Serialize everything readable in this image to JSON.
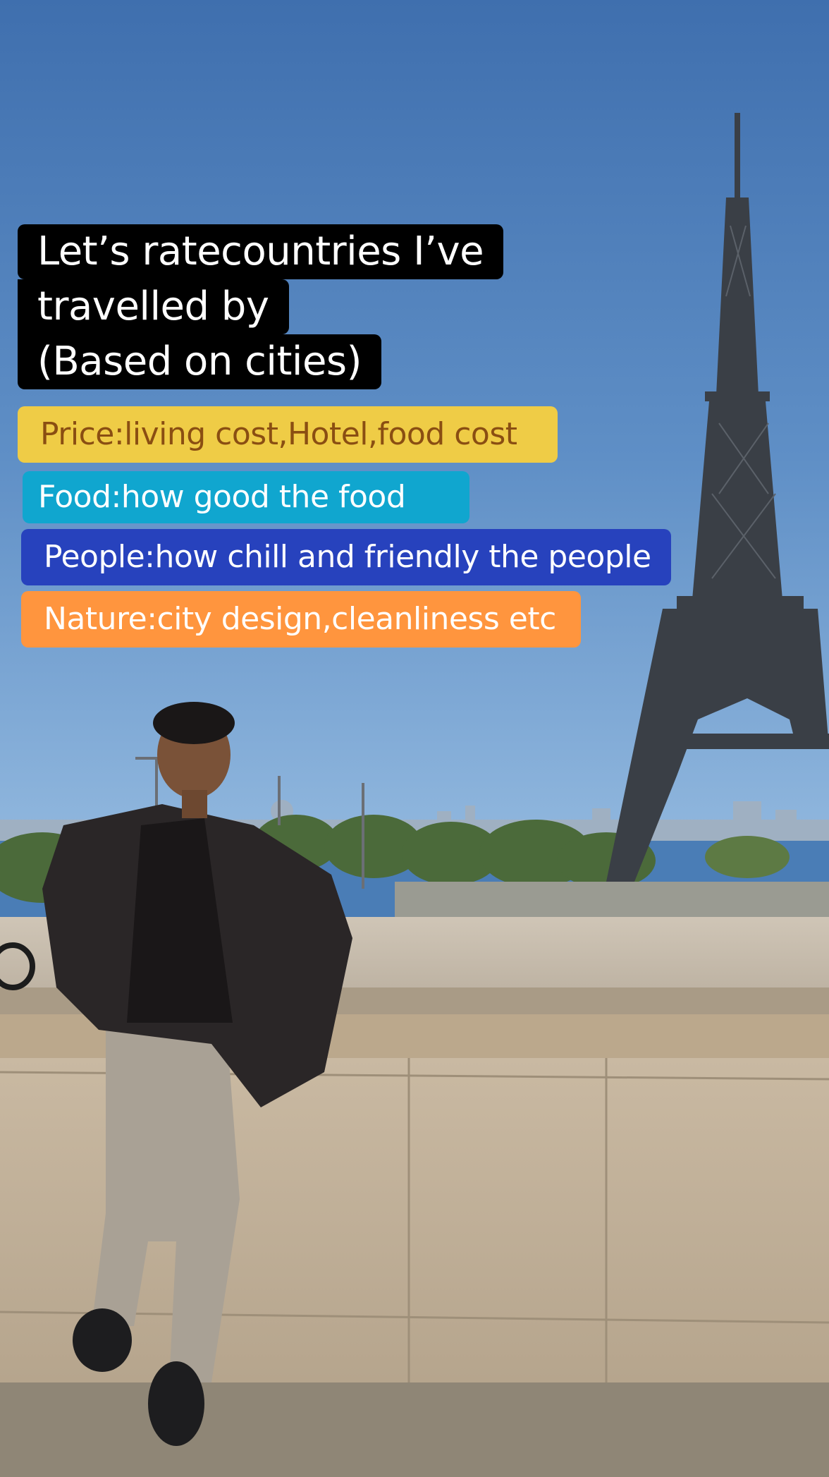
{
  "caption": {
    "title_lines": [
      "Let’s ratecountries I’ve",
      "travelled by",
      "(Based on cities)"
    ],
    "tags": {
      "price": "Price:living cost,Hotel,food cost",
      "food": "Food:how good the food",
      "people": "People:how chill and friendly the people",
      "nature": "Nature:city design,cleanliness etc"
    }
  },
  "colors": {
    "title_bg": "#000000",
    "price_bg": "#efcc46",
    "food_bg": "#10a6cf",
    "people_bg": "#2742bd",
    "nature_bg": "#ff953e"
  }
}
